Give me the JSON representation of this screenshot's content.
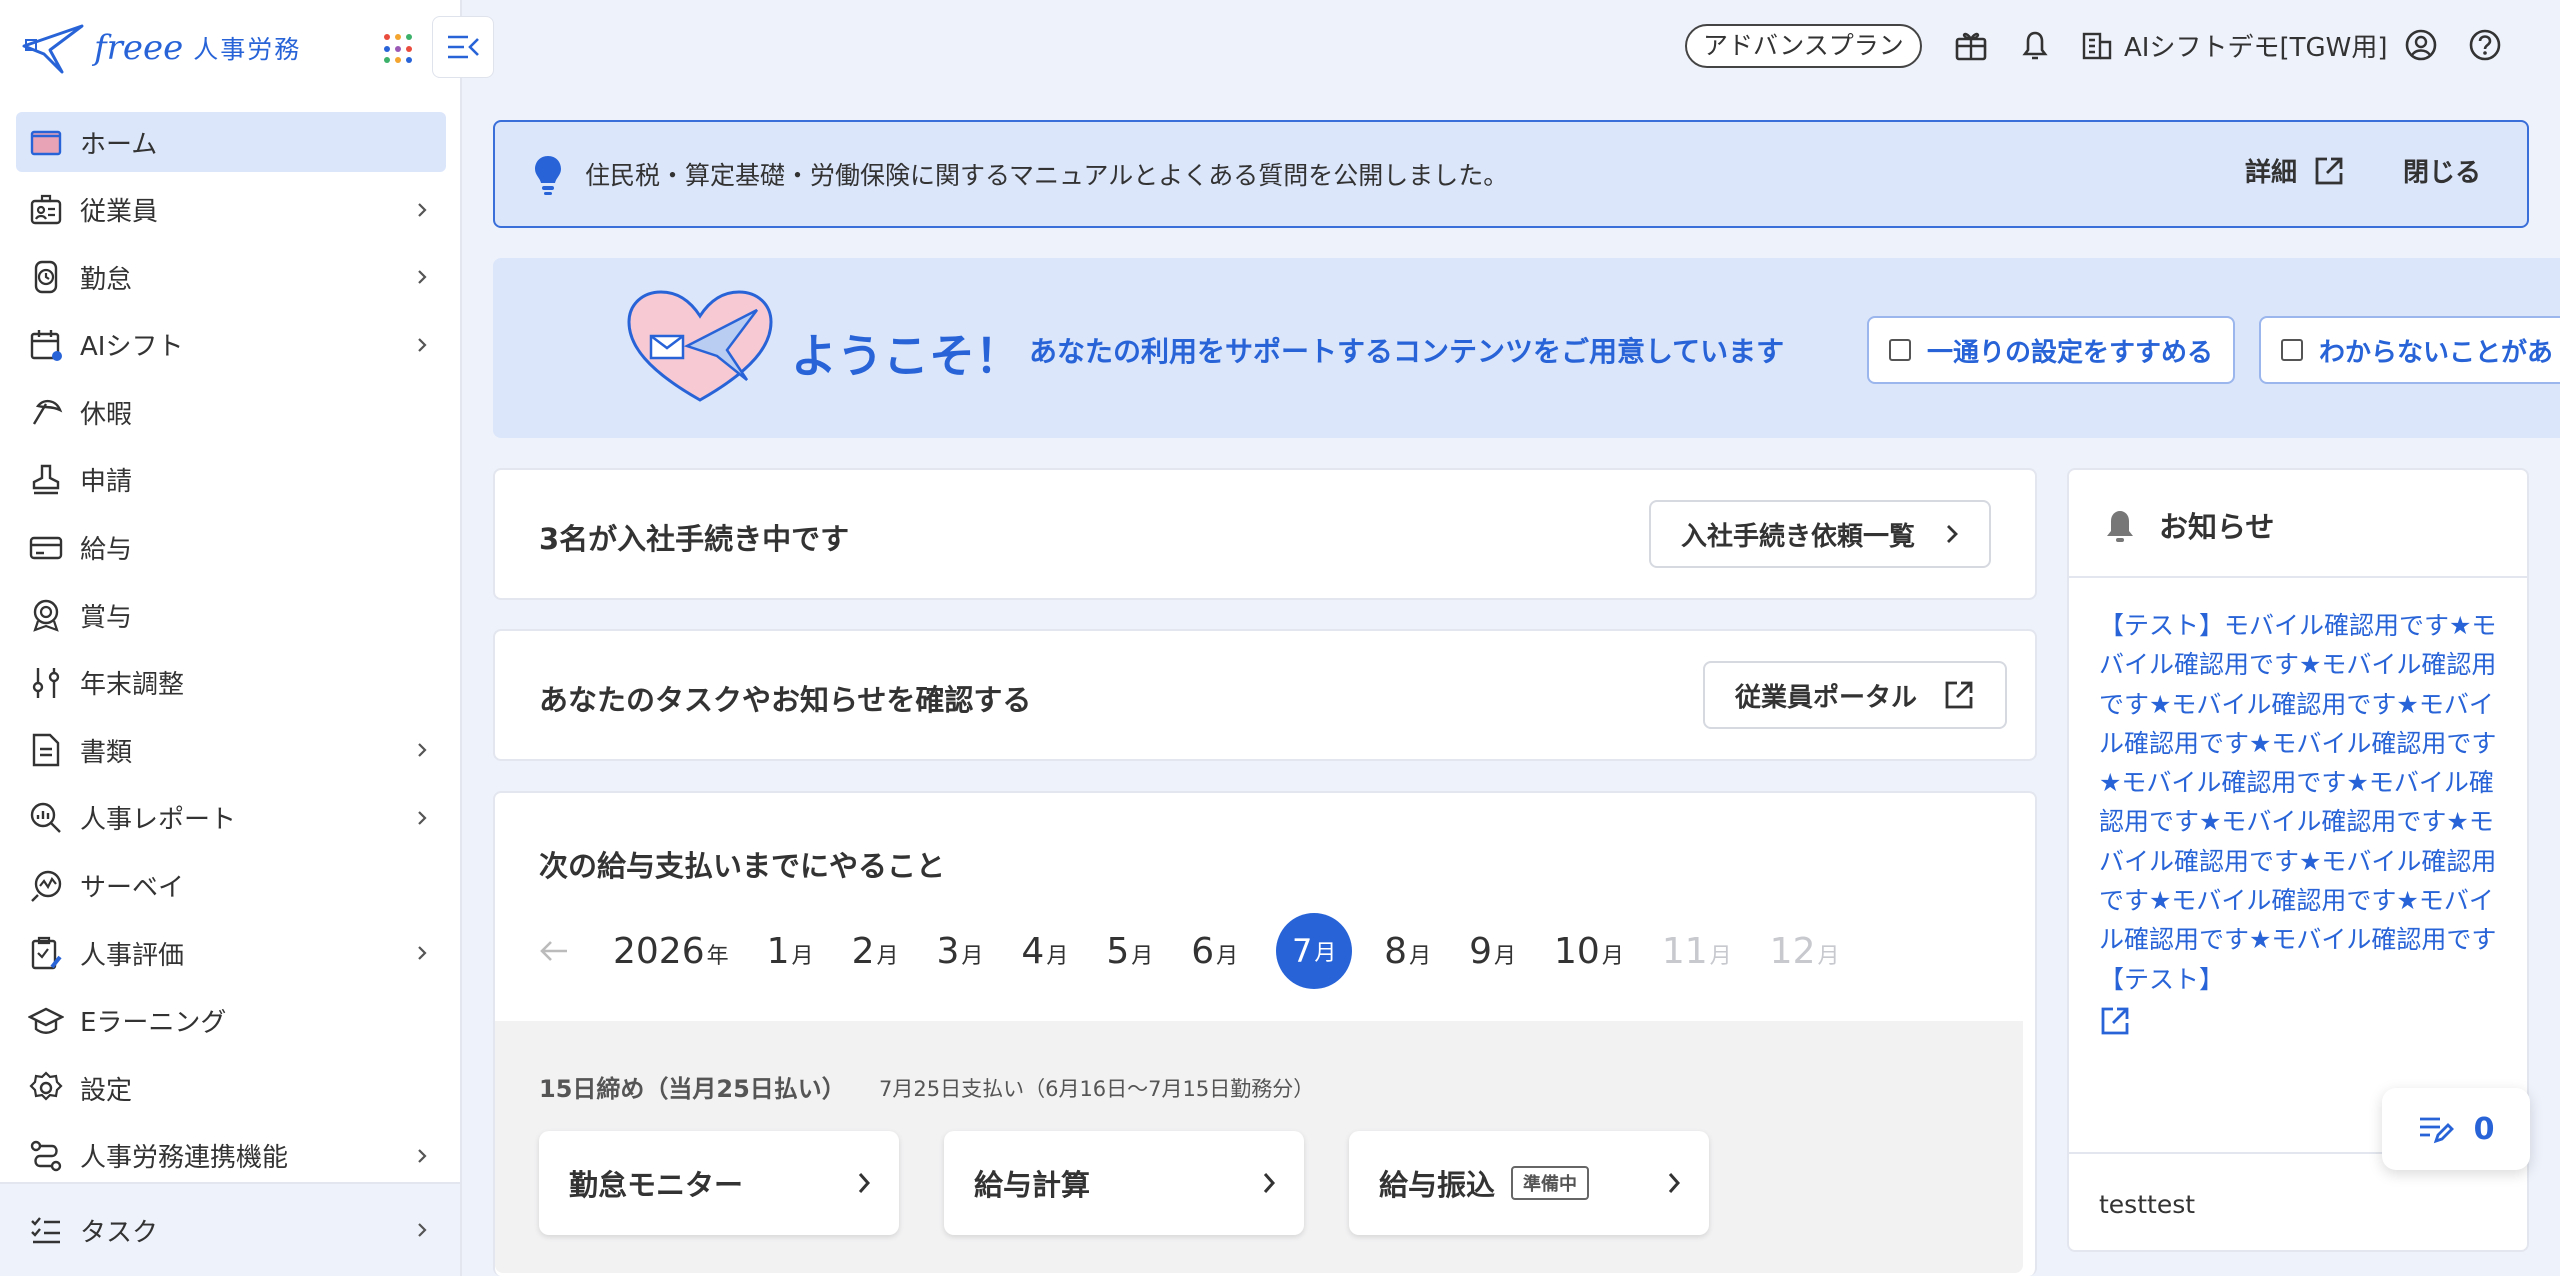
{
  "logo": {
    "brand": "freee",
    "product": "人事労務"
  },
  "sidebar": {
    "items": [
      {
        "label": "ホーム",
        "icon": "home-icon",
        "chevron": false,
        "active": true
      },
      {
        "label": "従業員",
        "icon": "employee-icon",
        "chevron": true
      },
      {
        "label": "勤怠",
        "icon": "attendance-icon",
        "chevron": true
      },
      {
        "label": "AIシフト",
        "icon": "calendar-icon",
        "chevron": true
      },
      {
        "label": "休暇",
        "icon": "vacation-icon",
        "chevron": false
      },
      {
        "label": "申請",
        "icon": "stamp-icon",
        "chevron": false
      },
      {
        "label": "給与",
        "icon": "card-icon",
        "chevron": false
      },
      {
        "label": "賞与",
        "icon": "bonus-icon",
        "chevron": false
      },
      {
        "label": "年末調整",
        "icon": "adjust-icon",
        "chevron": false
      },
      {
        "label": "書類",
        "icon": "document-icon",
        "chevron": true
      },
      {
        "label": "人事レポート",
        "icon": "report-icon",
        "chevron": true
      },
      {
        "label": "サーベイ",
        "icon": "survey-icon",
        "chevron": false
      },
      {
        "label": "人事評価",
        "icon": "evaluation-icon",
        "chevron": true
      },
      {
        "label": "Eラーニング",
        "icon": "elearning-icon",
        "chevron": false
      },
      {
        "label": "設定",
        "icon": "settings-icon",
        "chevron": false
      },
      {
        "label": "人事労務連携機能",
        "icon": "integration-icon",
        "chevron": true
      }
    ],
    "task": {
      "label": "タスク"
    }
  },
  "header": {
    "plan": "アドバンスプラン",
    "company": "AIシフトデモ[TGW用]"
  },
  "banner": {
    "text": "住民税・算定基礎・労働保険に関するマニュアルとよくある質問を公開しました。",
    "detail": "詳細",
    "close": "閉じる"
  },
  "welcome": {
    "title": "ようこそ！",
    "subtitle": "あなたの利用をサポートするコンテンツをご用意しています",
    "buttons": [
      "一通りの設定をすすめる",
      "わからないことがあ"
    ]
  },
  "onboarding": {
    "title": "3名が入社手続き中です",
    "button": "入社手続き依頼一覧"
  },
  "tasks_card": {
    "title": "あなたのタスクやお知らせを確認する",
    "button": "従業員ポータル"
  },
  "payroll": {
    "title": "次の給与支払いまでにやること",
    "year": "2026",
    "year_unit": "年",
    "month_unit": "月",
    "months": [
      "1",
      "2",
      "3",
      "4",
      "5",
      "6",
      "7",
      "8",
      "9",
      "10",
      "11",
      "12"
    ],
    "selected_month": "7",
    "disabled_months": [
      "11",
      "12"
    ],
    "cycle_title": "15日締め（当月25日払い）",
    "cycle_sub": "7月25日支払い（6月16日〜7月15日勤務分）",
    "steps": [
      {
        "label": "勤怠モニター",
        "badge": ""
      },
      {
        "label": "給与計算",
        "badge": ""
      },
      {
        "label": "給与振込",
        "badge": "準備中"
      }
    ]
  },
  "notice": {
    "title": "お知らせ",
    "body": "【テスト】モバイル確認用です★モバイル確認用です★モバイル確認用です★モバイル確認用です★モバイル確認用です★モバイル確認用です★モバイル確認用です★モバイル確認用です★モバイル確認用です★モバイル確認用です★モバイル確認用です★モバイル確認用です★モバイル確認用です★モバイル確認用です【テスト】",
    "footer": "testtest"
  },
  "counter": {
    "value": "0"
  },
  "colors": {
    "accent": "#2864d8",
    "bg": "#eef2fb",
    "active": "#dbe6fb"
  }
}
